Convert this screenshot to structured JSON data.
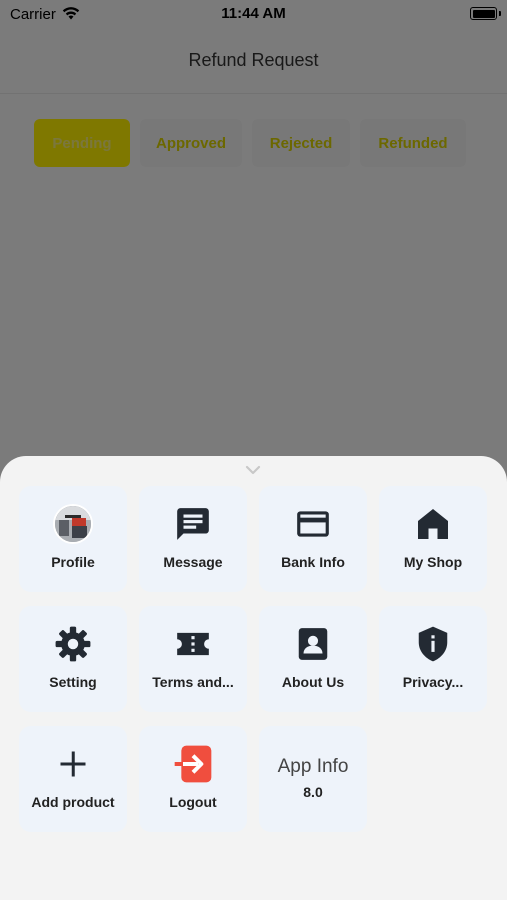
{
  "status_bar": {
    "carrier": "Carrier",
    "time": "11:44 AM"
  },
  "nav": {
    "title": "Refund Request"
  },
  "tabs": [
    {
      "label": "Pending",
      "active": true
    },
    {
      "label": "Approved",
      "active": false
    },
    {
      "label": "Rejected",
      "active": false
    },
    {
      "label": "Refunded",
      "active": false
    }
  ],
  "menu": {
    "items": [
      {
        "label": "Profile",
        "icon": "avatar"
      },
      {
        "label": "Message",
        "icon": "message-icon"
      },
      {
        "label": "Bank Info",
        "icon": "card-icon"
      },
      {
        "label": "My Shop",
        "icon": "home-icon"
      },
      {
        "label": "Setting",
        "icon": "gear-icon"
      },
      {
        "label": "Terms and...",
        "icon": "ticket-icon"
      },
      {
        "label": "About Us",
        "icon": "contact-icon"
      },
      {
        "label": "Privacy...",
        "icon": "shield-icon"
      },
      {
        "label": "Add product",
        "icon": "plus-icon"
      },
      {
        "label": "Logout",
        "icon": "logout-icon"
      }
    ],
    "app_info": {
      "title": "App Info",
      "version": "8.0"
    }
  },
  "colors": {
    "accent_yellow": "#fff100",
    "logout_red": "#f04e3e",
    "tile_bg": "#eef3fa",
    "sheet_bg": "#f3f3f3"
  }
}
